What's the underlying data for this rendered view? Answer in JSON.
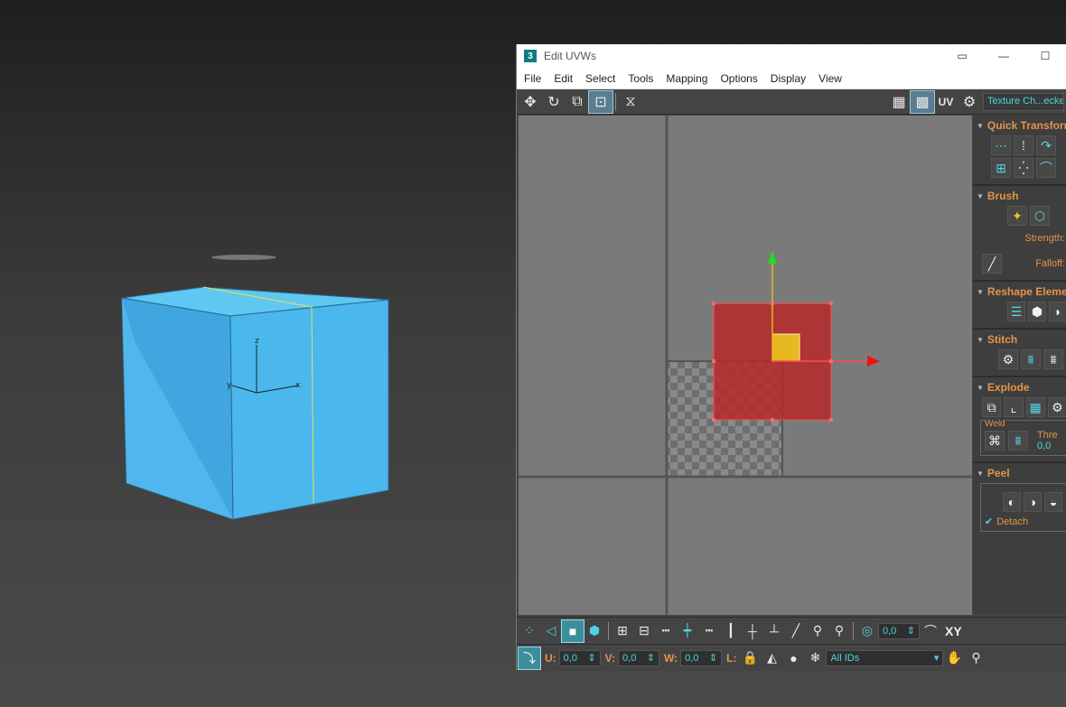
{
  "window": {
    "badge": "3",
    "title": "Edit UVWs",
    "controls": [
      "▭",
      "—",
      "☐"
    ]
  },
  "menu": [
    "File",
    "Edit",
    "Select",
    "Tools",
    "Mapping",
    "Options",
    "Display",
    "View"
  ],
  "toolbar_top": {
    "uv_label": "UV",
    "texture_select": "Texture Ch...ecke"
  },
  "viewport": {
    "axis_x": "x",
    "axis_y": "y",
    "axis_z": "z",
    "colors": {
      "cube": "#4ab8ec",
      "edge_selected": "#e8e050"
    }
  },
  "panel": {
    "quick_transform": "Quick Transform",
    "brush": "Brush",
    "strength_label": "Strength:",
    "falloff_label": "Falloff:",
    "reshape": "Reshape Elements",
    "stitch": "Stitch",
    "explode": "Explode",
    "weld_label": "Weld",
    "threshold_label": "Thre",
    "threshold_value": "0,0",
    "peel": "Peel",
    "detach_label": "Detach"
  },
  "bottom_toolbar": {
    "spinner_value": "0,0",
    "xy_label": "XY",
    "u_label": "U:",
    "u_value": "0,0",
    "v_label": "V:",
    "v_value": "0,0",
    "w_label": "W:",
    "w_value": "0,0",
    "l_label": "L:",
    "ids_select": "All IDs"
  },
  "colors": {
    "accent_orange": "#e6934a",
    "accent_cyan": "#4fd2e2",
    "selection_red": "#b82a2a",
    "selection_yellow": "#e8b820"
  }
}
